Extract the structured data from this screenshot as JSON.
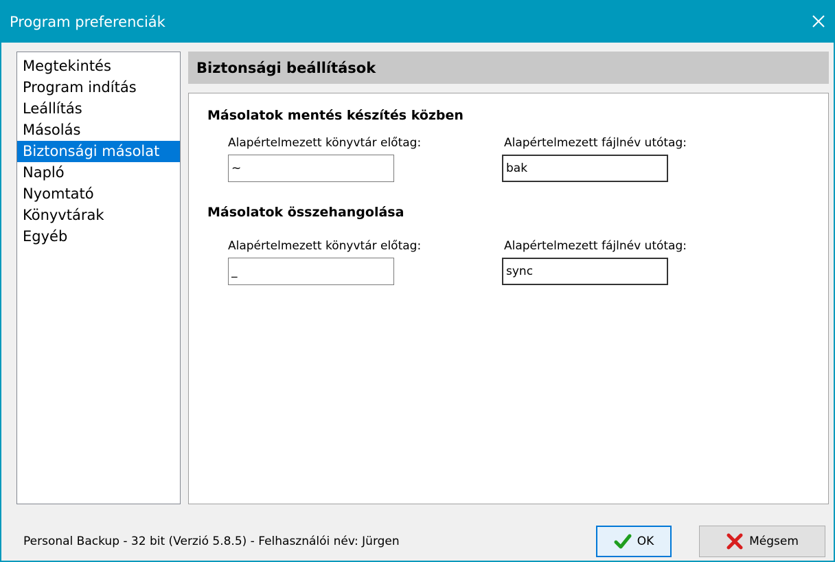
{
  "window": {
    "title": "Program preferenciák",
    "close_icon": "close-icon"
  },
  "nav": {
    "items": [
      {
        "label": "Megtekintés",
        "selected": false
      },
      {
        "label": "Program indítás",
        "selected": false
      },
      {
        "label": "Leállítás",
        "selected": false
      },
      {
        "label": "Másolás",
        "selected": false
      },
      {
        "label": "Biztonsági másolat",
        "selected": true
      },
      {
        "label": "Napló",
        "selected": false
      },
      {
        "label": "Nyomtató",
        "selected": false
      },
      {
        "label": "Könyvtárak",
        "selected": false
      },
      {
        "label": "Egyéb",
        "selected": false
      }
    ]
  },
  "panel": {
    "header": "Biztonsági beállítások",
    "groups": [
      {
        "title": "Másolatok mentés készítés közben",
        "dir_prefix_label": "Alapértelmezett könyvtár előtag:",
        "dir_prefix_value": "~",
        "file_suffix_label": "Alapértelmezett fájlnév utótag:",
        "file_suffix_value": "bak"
      },
      {
        "title": "Másolatok összehangolása",
        "dir_prefix_label": "Alapértelmezett könyvtár előtag:",
        "dir_prefix_value": "_",
        "file_suffix_label": "Alapértelmezett fájlnév utótag:",
        "file_suffix_value": "sync"
      }
    ]
  },
  "status": {
    "text": "Personal Backup - 32 bit (Verzió 5.8.5) - Felhasználói név: Jürgen"
  },
  "buttons": {
    "ok_label": "OK",
    "ok_icon": "checkmark-icon",
    "cancel_label": "Mégsem",
    "cancel_icon": "red-x-icon"
  },
  "colors": {
    "titlebar": "#0099bc",
    "selection": "#0078d7",
    "ok_check": "#1f9e1f",
    "cancel_x": "#d81e1e"
  }
}
